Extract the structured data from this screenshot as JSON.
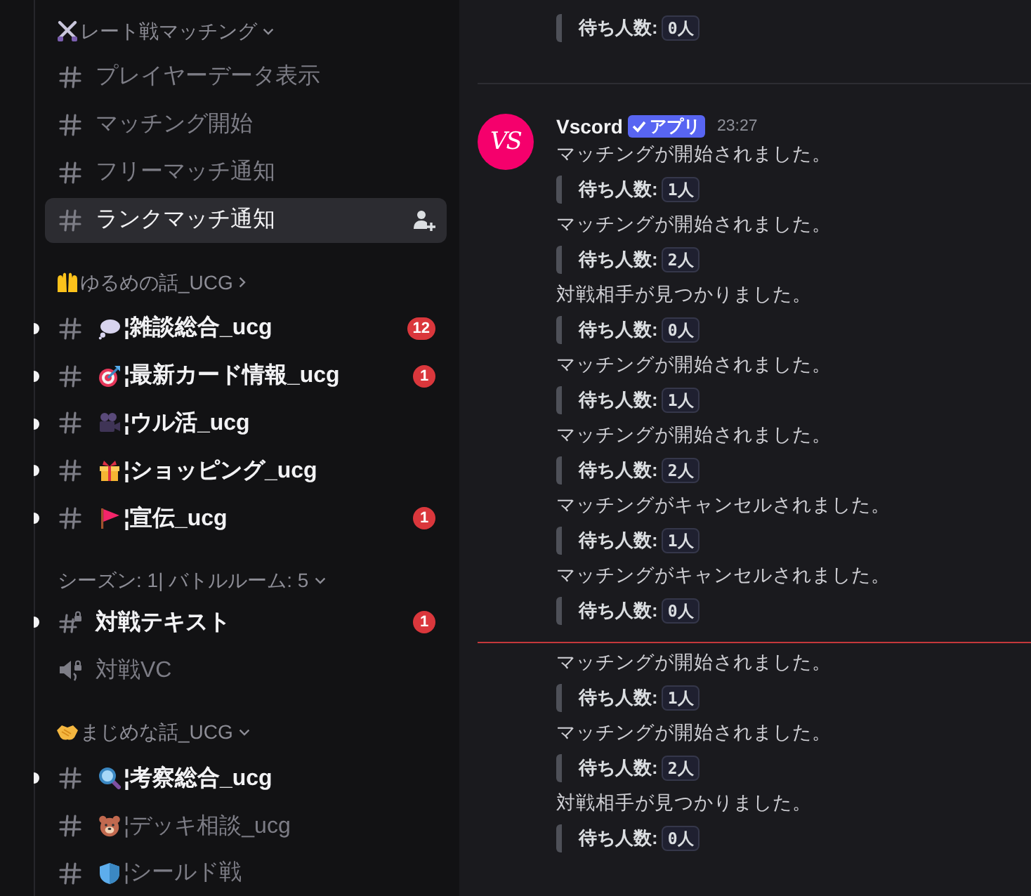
{
  "sidebar": {
    "categories": [
      {
        "name": "レート戦マッチング",
        "emoji": {
          "kind": "crossed-swords"
        },
        "collapsed": false,
        "channels": [
          {
            "kind": "text",
            "name": "プレイヤーデータ表示",
            "selected": false,
            "unread": false
          },
          {
            "kind": "text",
            "name": "マッチング開始",
            "selected": false,
            "unread": false
          },
          {
            "kind": "text",
            "name": "フリーマッチ通知",
            "selected": false,
            "unread": false
          },
          {
            "kind": "text",
            "name": "ランクマッチ通知",
            "selected": true,
            "unread": false
          }
        ]
      },
      {
        "name": "ゆるめの話_UCG",
        "emoji": {
          "kind": "raised-hands"
        },
        "collapsed": true,
        "channels": [
          {
            "kind": "text",
            "emoji": {
              "kind": "speech-bubble"
            },
            "name": "¦雑談総合_ucg",
            "selected": false,
            "unread": true,
            "mentions": "12"
          },
          {
            "kind": "text",
            "emoji": {
              "kind": "target"
            },
            "name": "¦最新カード情報_ucg",
            "selected": false,
            "unread": true,
            "mentions": "1"
          },
          {
            "kind": "text",
            "emoji": {
              "kind": "movie-camera"
            },
            "name": "¦ウル活_ucg",
            "selected": false,
            "unread": true
          },
          {
            "kind": "text",
            "emoji": {
              "kind": "gift"
            },
            "name": "¦ショッピング_ucg",
            "selected": false,
            "unread": true
          },
          {
            "kind": "text",
            "emoji": {
              "kind": "flag"
            },
            "name": "¦宣伝_ucg",
            "selected": false,
            "unread": true,
            "mentions": "1"
          }
        ]
      },
      {
        "name": "シーズン: 1| バトルルーム: 5",
        "collapsed": false,
        "channels": [
          {
            "kind": "locked-text",
            "name": "対戦テキスト",
            "selected": false,
            "unread": true,
            "mentions": "1"
          },
          {
            "kind": "locked-voice",
            "name": "対戦VC",
            "selected": false,
            "unread": false
          }
        ]
      },
      {
        "name": "まじめな話_UCG",
        "emoji": {
          "kind": "handshake"
        },
        "collapsed": false,
        "channels": [
          {
            "kind": "text",
            "emoji": {
              "kind": "magnifier"
            },
            "name": "¦考察総合_ucg",
            "selected": false,
            "unread": true
          },
          {
            "kind": "text",
            "emoji": {
              "kind": "bear"
            },
            "name": "¦デッキ相談_ucg",
            "selected": false,
            "unread": false
          },
          {
            "kind": "text",
            "emoji": {
              "kind": "shield"
            },
            "name": "¦シールド戦",
            "selected": false,
            "unread": false
          }
        ]
      }
    ]
  },
  "chat": {
    "previous_embed": {
      "label": "待ち人数:",
      "value": "0人"
    },
    "message": {
      "avatar_text": "VS",
      "author": "Vscord",
      "tag": "アプリ",
      "timestamp": "23:27",
      "items": [
        {
          "text": "マッチングが開始されました。",
          "label": "待ち人数:",
          "value": "1人",
          "new_marker": false
        },
        {
          "text": "マッチングが開始されました。",
          "label": "待ち人数:",
          "value": "2人",
          "new_marker": false
        },
        {
          "text": "対戦相手が見つかりました。",
          "label": "待ち人数:",
          "value": "0人",
          "new_marker": false
        },
        {
          "text": "マッチングが開始されました。",
          "label": "待ち人数:",
          "value": "1人",
          "new_marker": false
        },
        {
          "text": "マッチングが開始されました。",
          "label": "待ち人数:",
          "value": "2人",
          "new_marker": false
        },
        {
          "text": "マッチングがキャンセルされました。",
          "label": "待ち人数:",
          "value": "1人",
          "new_marker": false
        },
        {
          "text": "マッチングがキャンセルされました。",
          "label": "待ち人数:",
          "value": "0人",
          "new_marker": false
        },
        {
          "text": "マッチングが開始されました。",
          "label": "待ち人数:",
          "value": "1人",
          "new_marker": true
        },
        {
          "text": "マッチングが開始されました。",
          "label": "待ち人数:",
          "value": "2人",
          "new_marker": false
        },
        {
          "text": "対戦相手が見つかりました。",
          "label": "待ち人数:",
          "value": "0人",
          "new_marker": false
        }
      ]
    }
  }
}
